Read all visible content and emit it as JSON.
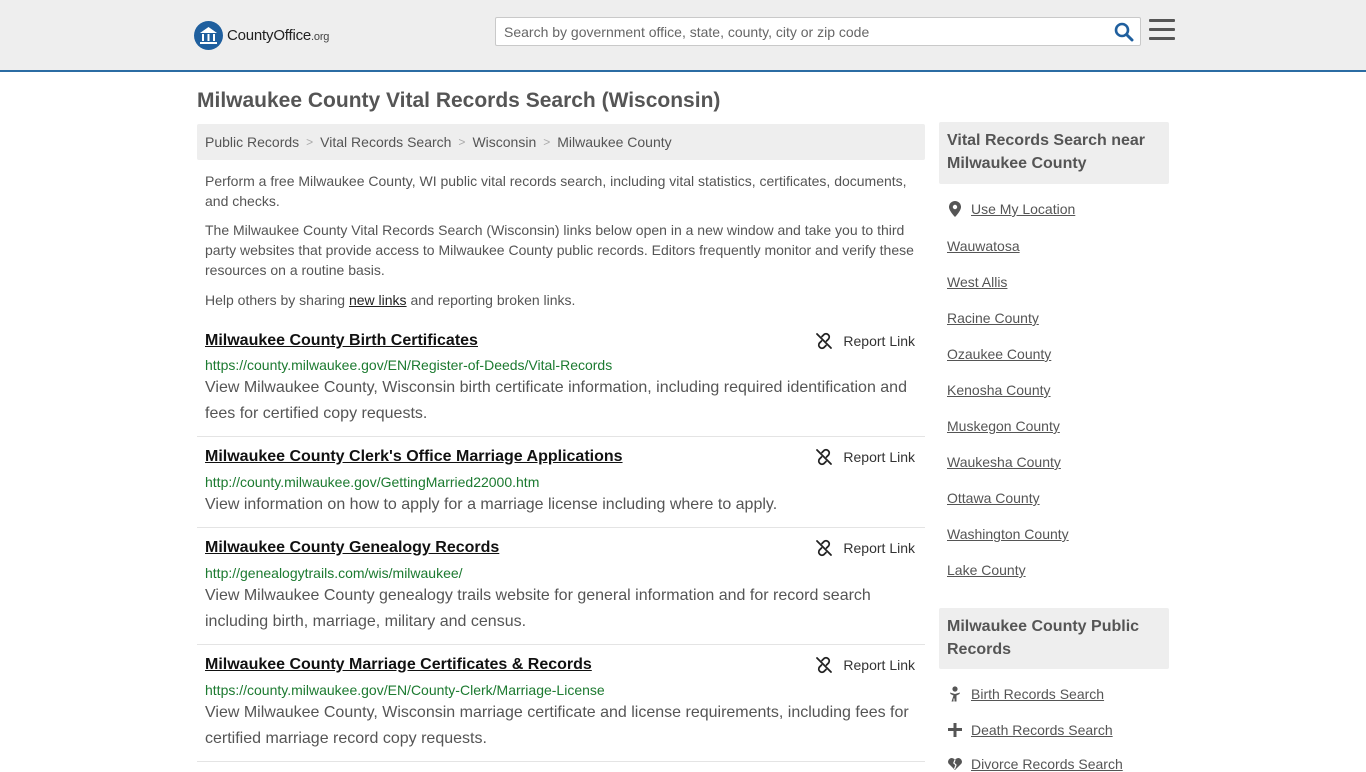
{
  "header": {
    "logo_main": "CountyOffice",
    "logo_suffix": ".org",
    "search_placeholder": "Search by government office, state, county, city or zip code"
  },
  "page_title": "Milwaukee County Vital Records Search (Wisconsin)",
  "breadcrumb": [
    "Public Records",
    "Vital Records Search",
    "Wisconsin",
    "Milwaukee County"
  ],
  "intro": {
    "p1": "Perform a free Milwaukee County, WI public vital records search, including vital statistics, certificates, documents, and checks.",
    "p2": "The Milwaukee County Vital Records Search (Wisconsin) links below open in a new window and take you to third party websites that provide access to Milwaukee County public records. Editors frequently monitor and verify these resources on a routine basis.",
    "p3_before": "Help others by sharing ",
    "p3_link": "new links",
    "p3_after": " and reporting broken links."
  },
  "report_label": "Report Link",
  "results": [
    {
      "title": "Milwaukee County Birth Certificates",
      "url": "https://county.milwaukee.gov/EN/Register-of-Deeds/Vital-Records",
      "desc": "View Milwaukee County, Wisconsin birth certificate information, including required identification and fees for certified copy requests."
    },
    {
      "title": "Milwaukee County Clerk's Office Marriage Applications",
      "url": "http://county.milwaukee.gov/GettingMarried22000.htm",
      "desc": "View information on how to apply for a marriage license including where to apply."
    },
    {
      "title": "Milwaukee County Genealogy Records",
      "url": "http://genealogytrails.com/wis/milwaukee/",
      "desc": "View Milwaukee County genealogy trails website for general information and for record search including birth, marriage, military and census."
    },
    {
      "title": "Milwaukee County Marriage Certificates & Records",
      "url": "https://county.milwaukee.gov/EN/County-Clerk/Marriage-License",
      "desc": "View Milwaukee County, Wisconsin marriage certificate and license requirements, including fees for certified marriage record copy requests."
    }
  ],
  "sidebar": {
    "nearby_heading": "Vital Records Search near Milwaukee County",
    "use_location": "Use My Location",
    "nearby": [
      "Wauwatosa",
      "West Allis",
      "Racine County",
      "Ozaukee County",
      "Kenosha County",
      "Muskegon County",
      "Waukesha County",
      "Ottawa County",
      "Washington County",
      "Lake County"
    ],
    "public_heading": "Milwaukee County Public Records",
    "public_links": [
      "Birth Records Search",
      "Death Records Search",
      "Divorce Records Search"
    ]
  }
}
